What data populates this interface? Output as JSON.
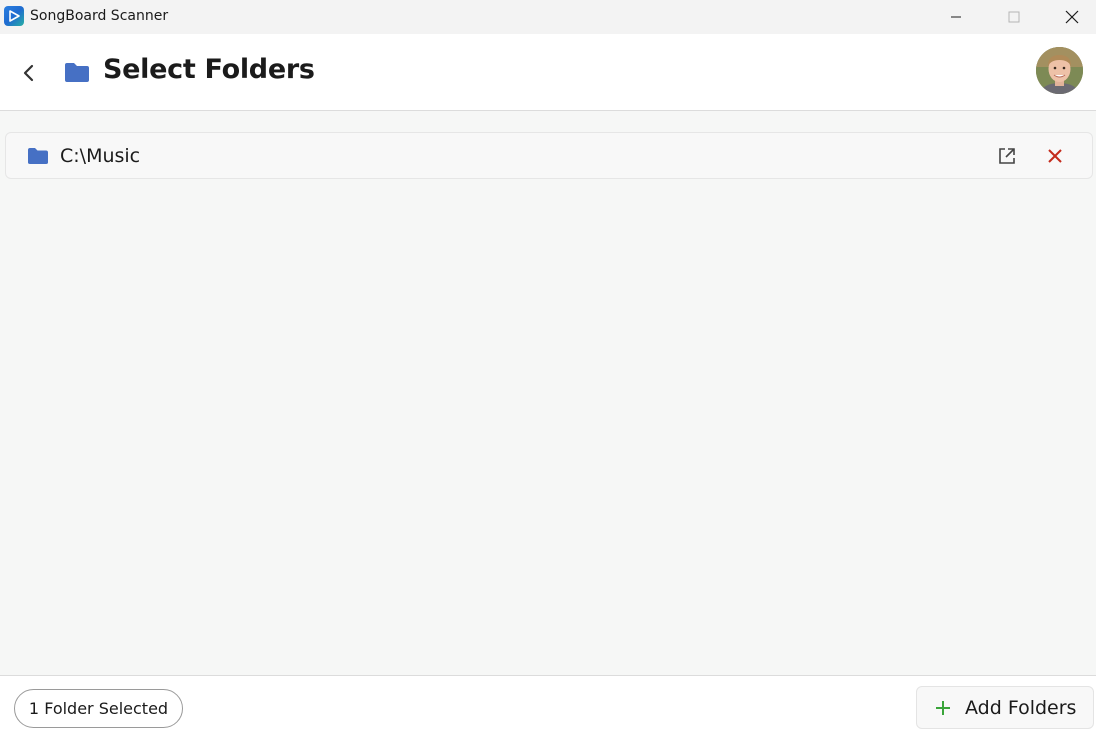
{
  "window": {
    "title": "SongBoard Scanner"
  },
  "header": {
    "title": "Select Folders"
  },
  "folders": [
    {
      "path": "C:\\Music"
    }
  ],
  "footer": {
    "selection_count": "1 Folder Selected",
    "add_label": "Add Folders"
  },
  "colors": {
    "folder_icon": "#4670c4",
    "remove_icon": "#c42b1c",
    "add_plus": "#3aa53a"
  },
  "icons": {
    "app": "play-icon",
    "back": "chevron-left-icon",
    "folder": "folder-icon",
    "open": "open-external-icon",
    "remove": "close-icon",
    "add": "plus-icon"
  }
}
